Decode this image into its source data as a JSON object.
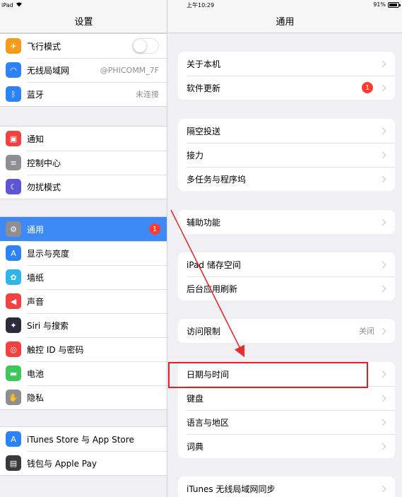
{
  "status": {
    "device": "iPad",
    "time": "上午10:29",
    "battery": "91%",
    "battery_level": 0.91
  },
  "left": {
    "title": "设置",
    "groups": [
      [
        {
          "label": "飞行模式",
          "icon": "airplane-icon",
          "color": "#f49a1d",
          "control": "toggle"
        },
        {
          "label": "无线局域网",
          "icon": "wifi-icon",
          "color": "#2d83f5",
          "value": "@PHICOMM_7F"
        },
        {
          "label": "蓝牙",
          "icon": "bluetooth-icon",
          "color": "#2d83f5",
          "value": "未连接"
        }
      ],
      [
        {
          "label": "通知",
          "icon": "notification-icon",
          "color": "#f2413f"
        },
        {
          "label": "控制中心",
          "icon": "control-center-icon",
          "color": "#8e8e93"
        },
        {
          "label": "勿扰模式",
          "icon": "moon-icon",
          "color": "#5e55d6"
        }
      ],
      [
        {
          "label": "通用",
          "icon": "gear-icon",
          "color": "#8e8e93",
          "badge": "1",
          "selected": true
        },
        {
          "label": "显示与亮度",
          "icon": "display-icon",
          "color": "#2d83f5"
        },
        {
          "label": "墙纸",
          "icon": "wallpaper-icon",
          "color": "#2fb6e6"
        },
        {
          "label": "声音",
          "icon": "sound-icon",
          "color": "#f2413f"
        },
        {
          "label": "Siri 与搜索",
          "icon": "siri-icon",
          "color": "#2b2b3a"
        },
        {
          "label": "触控 ID 与密码",
          "icon": "fingerprint-icon",
          "color": "#f2413f"
        },
        {
          "label": "电池",
          "icon": "battery-icon",
          "color": "#3cc85a"
        },
        {
          "label": "隐私",
          "icon": "hand-icon",
          "color": "#8e8e93"
        }
      ],
      [
        {
          "label": "iTunes Store 与 App Store",
          "icon": "app-store-icon",
          "color": "#2d83f5"
        },
        {
          "label": "钱包与 Apple Pay",
          "icon": "wallet-icon",
          "color": "#3a3a3c"
        }
      ]
    ]
  },
  "right": {
    "title": "通用",
    "groups": [
      [
        {
          "label": "关于本机"
        },
        {
          "label": "软件更新",
          "badge": "1"
        }
      ],
      [
        {
          "label": "隔空投送"
        },
        {
          "label": "接力"
        },
        {
          "label": "多任务与程序坞"
        }
      ],
      [
        {
          "label": "辅助功能"
        }
      ],
      [
        {
          "label": "iPad 储存空间"
        },
        {
          "label": "后台应用刷新"
        }
      ],
      [
        {
          "label": "访问限制",
          "value": "关闭"
        }
      ],
      [
        {
          "label": "日期与时间"
        },
        {
          "label": "键盘"
        },
        {
          "label": "语言与地区"
        },
        {
          "label": "词典"
        }
      ],
      [
        {
          "label": "iTunes 无线局域网同步"
        }
      ]
    ]
  },
  "annotation": {
    "highlight_color": "#d9212c"
  }
}
